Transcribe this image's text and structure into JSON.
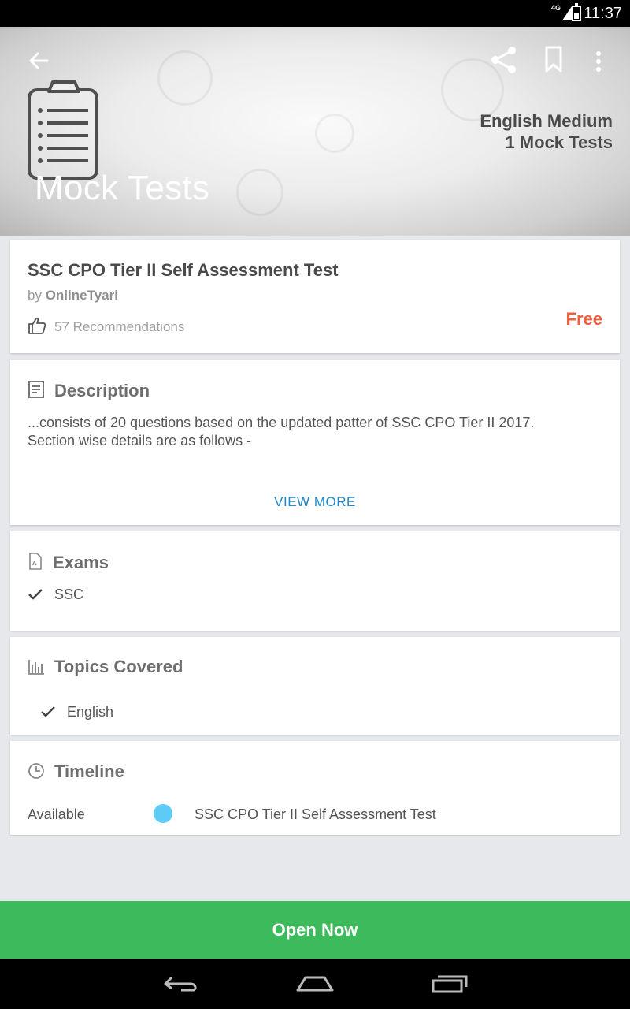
{
  "status_bar": {
    "time": "11:37",
    "network": "4G",
    "icons": [
      "signal-icon",
      "battery-icon"
    ]
  },
  "header": {
    "title": "Mock Tests",
    "medium": "English Medium",
    "count": "1 Mock Tests",
    "actions": [
      "back-arrow-icon",
      "share-icon",
      "bookmark-icon",
      "more-vert-icon"
    ]
  },
  "test": {
    "title": "SSC CPO Tier II Self Assessment Test",
    "by_prefix": "by",
    "author": "OnlineTyari",
    "recommendations": "57 Recommendations",
    "price": "Free"
  },
  "description": {
    "heading": "Description",
    "text": "...consists of 20 questions based on the updated patter of SSC CPO Tier II 2017. Section wise details are as follows -",
    "view_more": "VIEW MORE"
  },
  "exams": {
    "heading": "Exams",
    "items": [
      "SSC"
    ]
  },
  "topics": {
    "heading": "Topics Covered",
    "items": [
      "English"
    ]
  },
  "timeline": {
    "heading": "Timeline",
    "status": "Available",
    "item": "SSC CPO Tier II Self Assessment Test"
  },
  "open_button": {
    "label": "Open Now"
  },
  "colors": {
    "price": "#f0603f",
    "link": "#1e88c9",
    "button": "#3dbb5c",
    "timeline_dot": "#5ecbf6"
  }
}
